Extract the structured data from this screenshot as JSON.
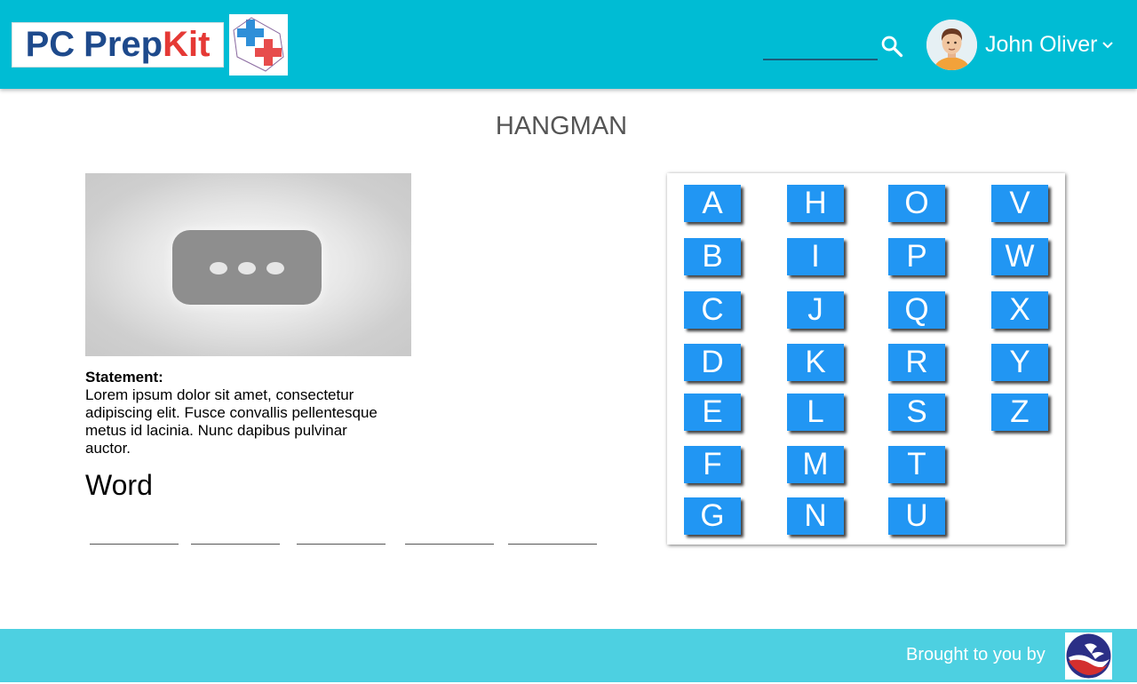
{
  "header": {
    "logo_text_pc": "PC",
    "logo_text_prep": "Prep",
    "logo_text_kit": "Kit",
    "search_icon": "search-icon",
    "user_name": "John Oliver",
    "dropdown_icon": "chevron-down-icon"
  },
  "page": {
    "title": "HANGMAN"
  },
  "content": {
    "video_icon": "loading-dots-icon",
    "statement_label": "Statement:",
    "statement_text": "Lorem ipsum dolor sit amet, consectetur adipiscing elit. Fusce convallis pellentesque metus id lacinia. Nunc dapibus pulvinar auctor.",
    "word_label": "Word",
    "blank_count": 5
  },
  "letters": {
    "col1": [
      "A",
      "B",
      "C",
      "D",
      "E",
      "F",
      "G"
    ],
    "col2": [
      "H",
      "I",
      "J",
      "K",
      "L",
      "M",
      "N"
    ],
    "col3": [
      "O",
      "P",
      "Q",
      "R",
      "S",
      "T",
      "U"
    ],
    "col4": [
      "V",
      "W",
      "X",
      "Y",
      "Z"
    ]
  },
  "footer": {
    "brought_by": "Brought to you by"
  },
  "colors": {
    "header_bg": "#00bcd4",
    "footer_bg": "#4dd0e1",
    "letter_button": "#2196f3"
  }
}
